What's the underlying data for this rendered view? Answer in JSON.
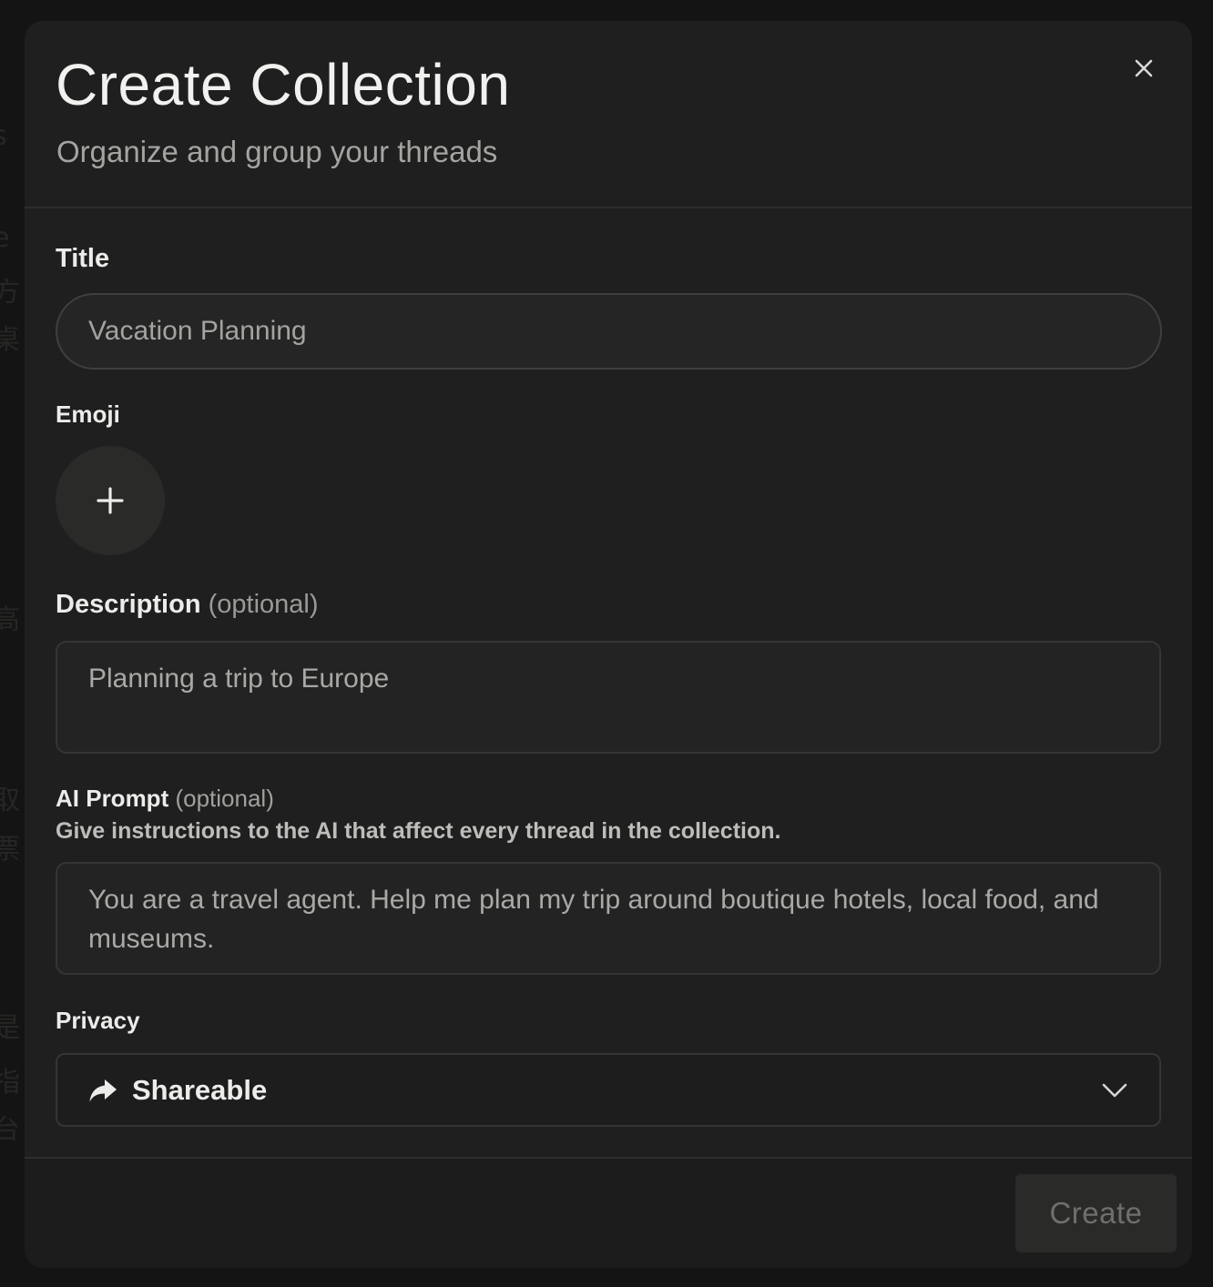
{
  "dialog": {
    "title": "Create Collection",
    "subtitle": "Organize and group your threads"
  },
  "fields": {
    "title": {
      "label": "Title",
      "value": "Vacation Planning"
    },
    "emoji": {
      "label": "Emoji",
      "icon": "plus-icon"
    },
    "description": {
      "label": "Description",
      "optional_tag": "(optional)",
      "value": "Planning a trip to Europe"
    },
    "ai_prompt": {
      "label": "AI Prompt",
      "optional_tag": "(optional)",
      "hint": "Give instructions to the AI that affect every thread in the collection.",
      "value": "You are a travel agent. Help me plan my trip around boutique hotels, local food, and museums."
    },
    "privacy": {
      "label": "Privacy",
      "selected": "Shareable",
      "icon": "share-arrow-icon"
    }
  },
  "footer": {
    "create_label": "Create"
  },
  "colors": {
    "modal_bg": "#1f1f1f",
    "page_bg": "#141414",
    "text": "#ececea",
    "muted": "#a4a4a1",
    "disabled_button": "#2a2a29"
  }
}
